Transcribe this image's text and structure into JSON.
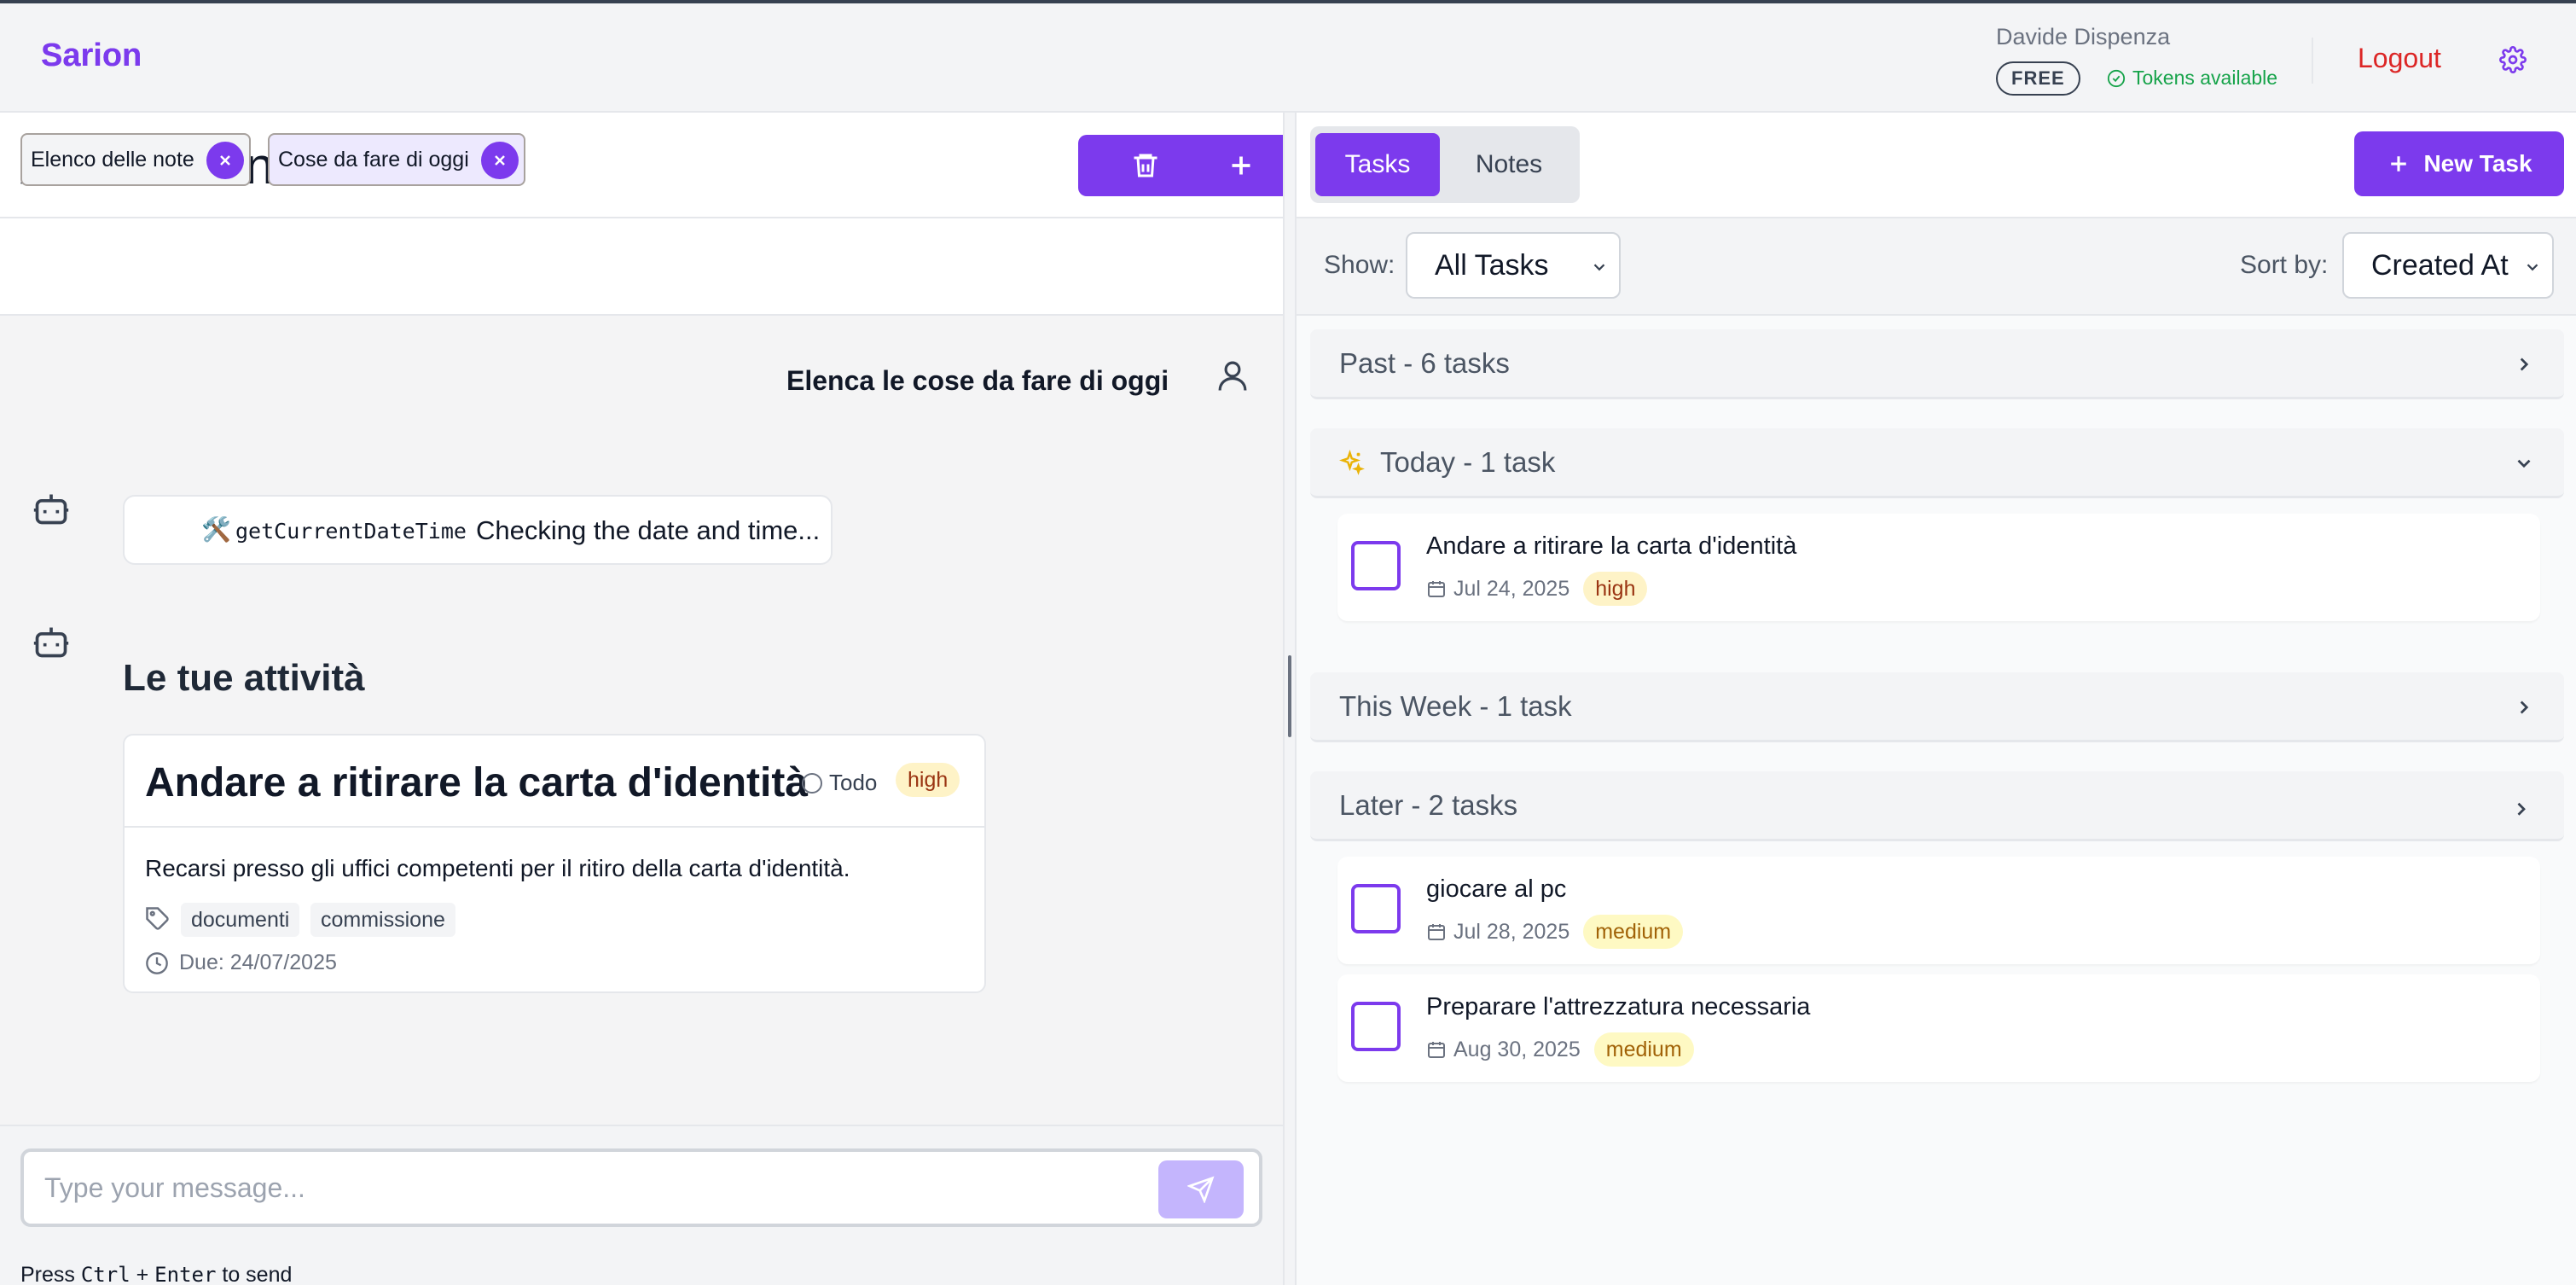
{
  "header": {
    "brand": "Sarion",
    "user_name": "Davide Dispenza",
    "plan": "FREE",
    "tokens_status": "Tokens available",
    "logout_label": "Logout"
  },
  "assistant": {
    "title": "AI Assistant",
    "context_chips": [
      {
        "label": "Elenco delle note"
      },
      {
        "label": "Cose da fare di oggi"
      }
    ],
    "messages": {
      "user_text": "Elenca le cose da fare di oggi",
      "tool_emoji": "🛠️",
      "tool_name": "getCurrentDateTime",
      "tool_status": "Checking the date and time...",
      "section_heading": "Le tue attività"
    },
    "task_card": {
      "title": "Andare a ritirare la carta d'identità",
      "status": "Todo",
      "priority": "high",
      "description": "Recarsi presso gli uffici competenti per il ritiro della carta d'identità.",
      "tags": [
        "documenti",
        "commissione"
      ],
      "due": "Due: 24/07/2025"
    },
    "input": {
      "placeholder": "Type your message...",
      "hint_prefix": "Press",
      "hint_key1": "Ctrl",
      "hint_plus": "+",
      "hint_key2": "Enter",
      "hint_suffix": "to send"
    }
  },
  "tasks_panel": {
    "tabs": {
      "active": "Tasks",
      "inactive": "Notes"
    },
    "new_task_label": "New Task",
    "show_label": "Show:",
    "show_value": "All Tasks",
    "sort_label": "Sort by:",
    "sort_value": "Created At",
    "groups": {
      "past": "Past - 6 tasks",
      "today": "Today - 1 task",
      "this_week": "This Week - 1 task",
      "later": "Later - 2 tasks"
    },
    "today_items": [
      {
        "title": "Andare a ritirare la carta d'identità",
        "date": "Jul 24, 2025",
        "priority": "high"
      }
    ],
    "later_items": [
      {
        "title": "giocare al pc",
        "date": "Jul 28, 2025",
        "priority": "medium"
      },
      {
        "title": "Preparare l'attrezzatura necessaria",
        "date": "Aug 30, 2025",
        "priority": "medium"
      }
    ]
  },
  "colors": {
    "accent": "#7c3aed",
    "logout": "#dc2626",
    "tokens_ok": "#16a34a",
    "priority_high_bg": "#fef3c7",
    "priority_medium_bg": "#fef9c3"
  },
  "icons": [
    "settings-gear-icon",
    "trash-icon",
    "plus-icon",
    "close-icon",
    "user-icon",
    "robot-icon",
    "tag-icon",
    "clock-icon",
    "send-icon",
    "calendar-icon",
    "sparkles-icon",
    "chevron-right-icon",
    "chevron-down-icon",
    "check-circle-icon"
  ]
}
